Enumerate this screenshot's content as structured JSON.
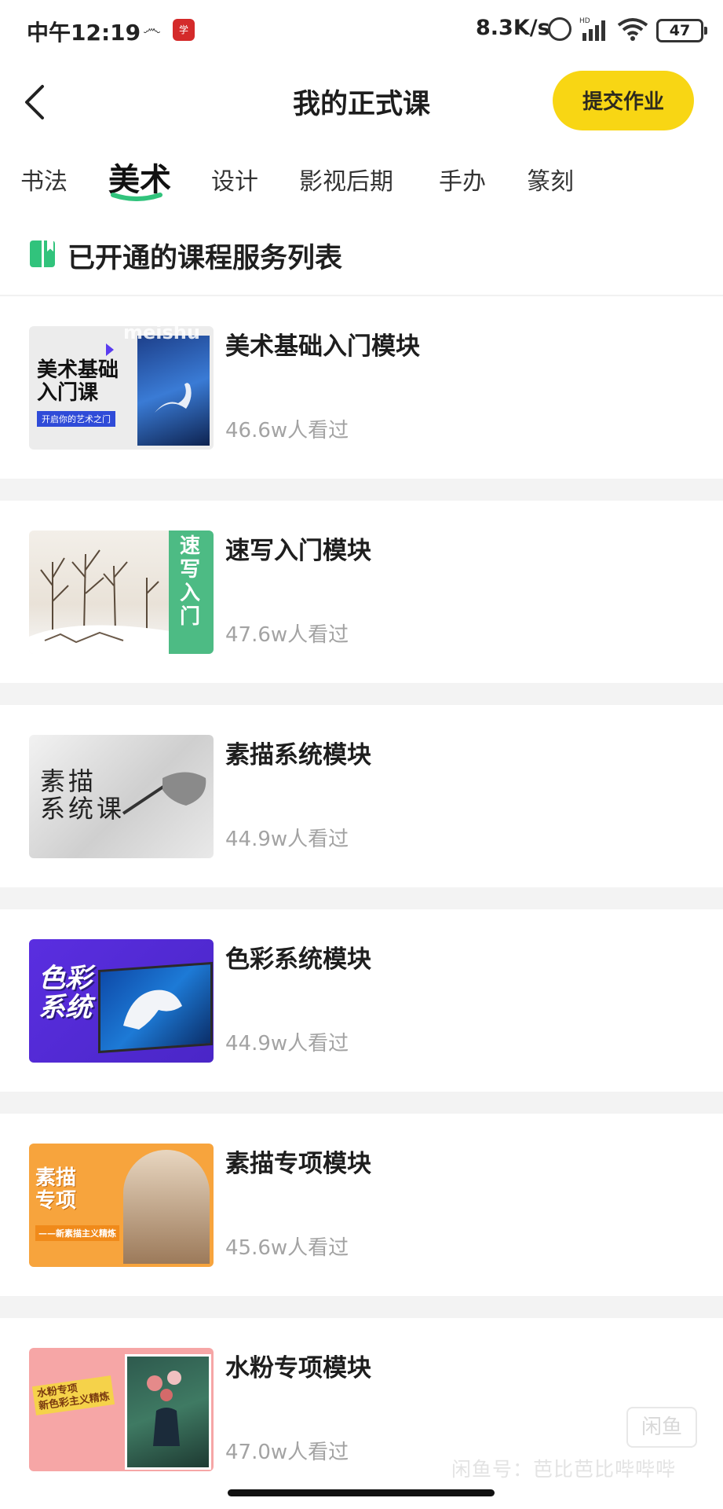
{
  "status_bar": {
    "time": "中午12:19",
    "speed": "8.3K/s",
    "battery": "47"
  },
  "header": {
    "title": "我的正式课",
    "submit_label": "提交作业"
  },
  "tabs": [
    {
      "label": "书法"
    },
    {
      "label": "美术"
    },
    {
      "label": "设计"
    },
    {
      "label": "影视后期"
    },
    {
      "label": "手办"
    },
    {
      "label": "篆刻"
    }
  ],
  "section": {
    "title": "已开通的课程服务列表"
  },
  "courses": [
    {
      "title": "美术基础入门模块",
      "views": "46.6w人看过"
    },
    {
      "title": "速写入门模块",
      "views": "47.6w人看过"
    },
    {
      "title": "素描系统模块",
      "views": "44.9w人看过"
    },
    {
      "title": "色彩系统模块",
      "views": "44.9w人看过"
    },
    {
      "title": "素描专项模块",
      "views": "45.6w人看过"
    },
    {
      "title": "水粉专项模块",
      "views": "47.0w人看过"
    }
  ],
  "thumb_texts": {
    "t1_main": "美术基础\n入门课",
    "t1_sub": "开启你的艺术之门",
    "t1_top": "meishu",
    "t2_vert": "速写入门",
    "t3_main": "素描\n系统课",
    "t4_main": "色彩\n系统",
    "t5_main": "素描\n专项",
    "t5_sub": "——新素描主义精炼",
    "t6_main": "水粉专项\n新色彩主义精炼"
  },
  "watermark": {
    "box": "闲鱼",
    "text": "闲鱼号：芭比芭比哔哔哔"
  },
  "colors": {
    "accent_yellow": "#f8d614",
    "accent_green": "#31c37c",
    "muted_text": "#a3a3a3"
  }
}
